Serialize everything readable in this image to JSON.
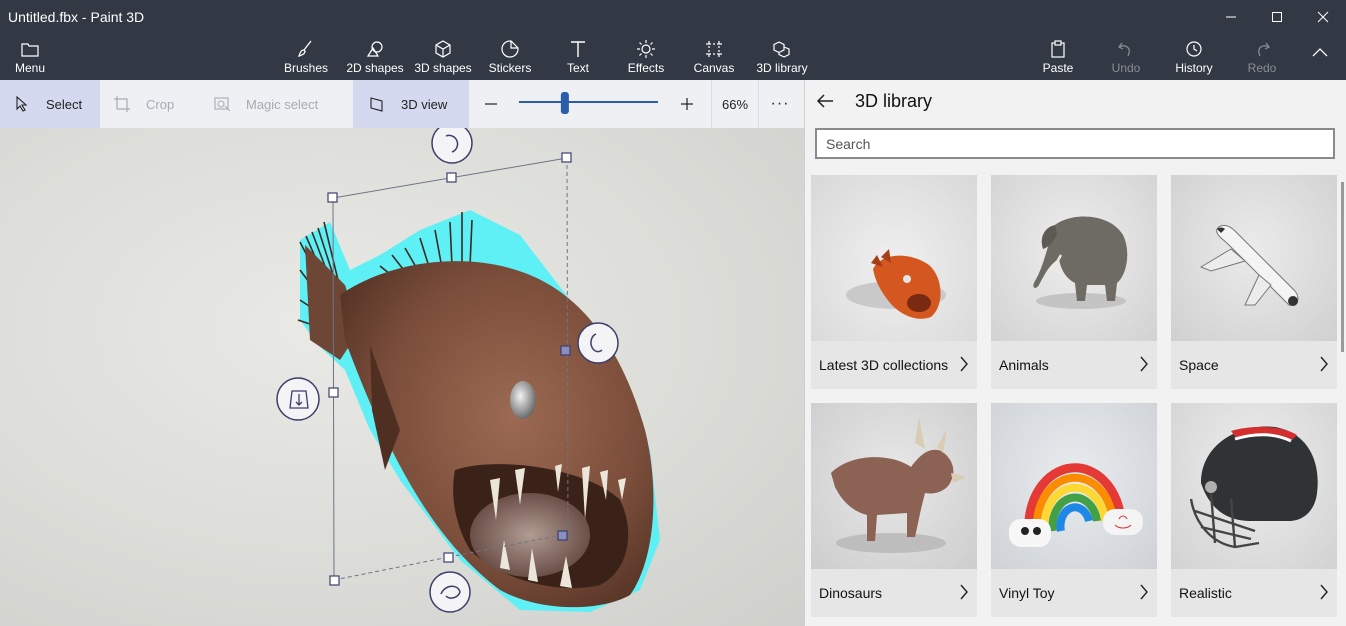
{
  "window": {
    "title": "Untitled.fbx - Paint 3D",
    "minimize": "—",
    "maximize": "☐",
    "close": "✕"
  },
  "ribbon": {
    "menu": "Menu",
    "brushes": "Brushes",
    "shapes_2d": "2D shapes",
    "shapes_3d": "3D shapes",
    "stickers": "Stickers",
    "text": "Text",
    "effects": "Effects",
    "canvas": "Canvas",
    "library_3d": "3D library",
    "paste": "Paste",
    "undo": "Undo",
    "history": "History",
    "redo": "Redo"
  },
  "toolbar": {
    "select": "Select",
    "crop": "Crop",
    "magic_select": "Magic select",
    "view_3d": "3D view",
    "zoom_percent": "66%",
    "zoom_level": 0.33,
    "more": "···"
  },
  "panel": {
    "title": "3D library",
    "search_placeholder": "Search",
    "cards": [
      {
        "label": "Latest 3D collections",
        "icon": "fish-model"
      },
      {
        "label": "Animals",
        "icon": "elephant-model"
      },
      {
        "label": "Space",
        "icon": "space-shuttle-model"
      },
      {
        "label": "Dinosaurs",
        "icon": "triceratops-model"
      },
      {
        "label": "Vinyl Toy",
        "icon": "rainbow-toy-model"
      },
      {
        "label": "Realistic",
        "icon": "football-helmet-model"
      }
    ]
  },
  "colors": {
    "titlebar": "#333944",
    "toolbar": "#eef0f3",
    "selected_tool": "#d4d9f0",
    "selection_glow": "#5ff0f5",
    "panel": "#f2f2f2"
  }
}
